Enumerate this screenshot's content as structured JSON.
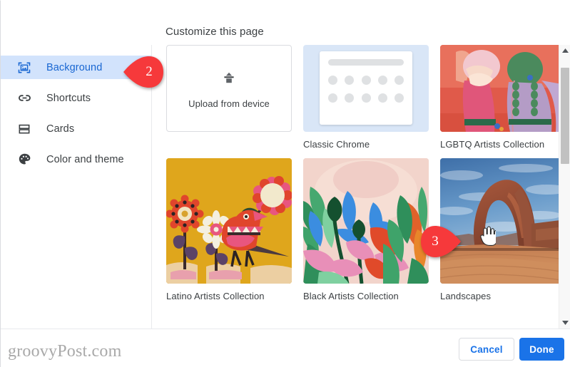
{
  "dialog": {
    "title": "Customize this page"
  },
  "sidebar": {
    "items": [
      {
        "label": "Background",
        "icon": "image-icon",
        "selected": true
      },
      {
        "label": "Shortcuts",
        "icon": "link-icon",
        "selected": false
      },
      {
        "label": "Cards",
        "icon": "cards-icon",
        "selected": false
      },
      {
        "label": "Color and theme",
        "icon": "palette-icon",
        "selected": false
      }
    ]
  },
  "content": {
    "upload": {
      "label": "Upload from device",
      "icon": "upload-icon"
    },
    "tiles": [
      {
        "caption": "Classic Chrome",
        "art": "classic-chrome"
      },
      {
        "caption": "LGBTQ Artists Collection",
        "art": "lgbtq"
      },
      {
        "caption": "Latino Artists Collection",
        "art": "latino"
      },
      {
        "caption": "Black Artists Collection",
        "art": "black-artists"
      },
      {
        "caption": "Landscapes",
        "art": "landscapes"
      }
    ]
  },
  "footer": {
    "cancel_label": "Cancel",
    "done_label": "Done"
  },
  "watermark": {
    "text": "groovyPost.com"
  },
  "callouts": [
    {
      "number": "2"
    },
    {
      "number": "3"
    }
  ],
  "colors": {
    "accent": "#1a73e8",
    "selected_row_bg": "#d2e3fc",
    "selected_text": "#1967d2",
    "callout_red": "#f6393b",
    "text": "#3c4043"
  }
}
